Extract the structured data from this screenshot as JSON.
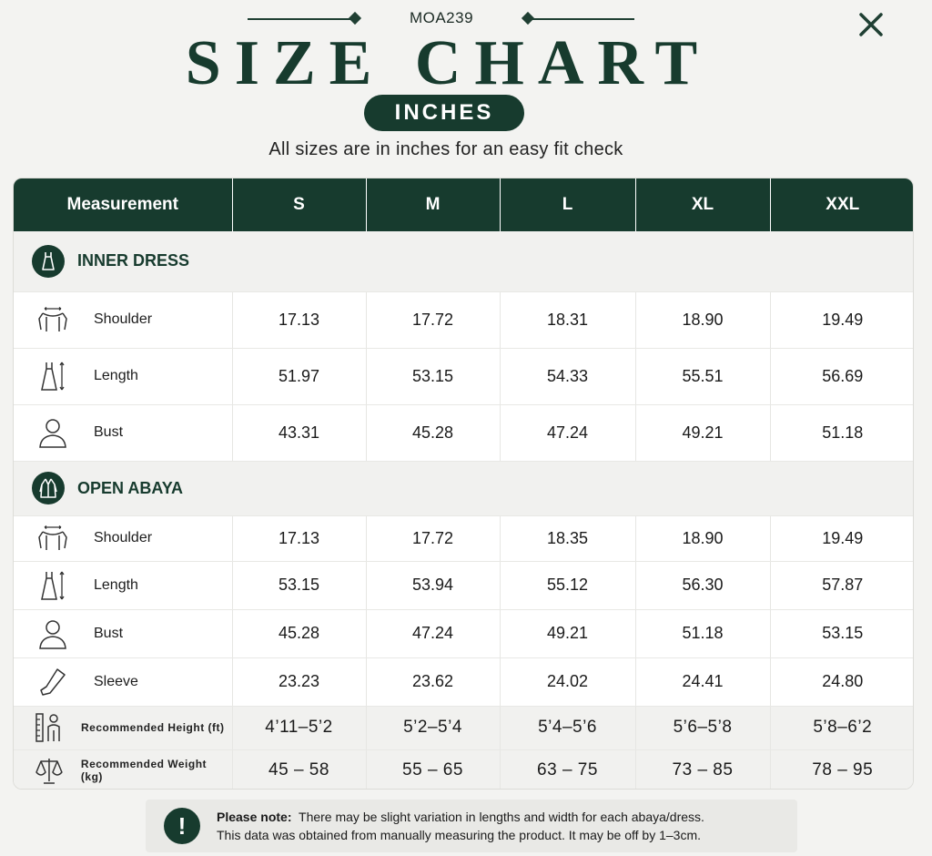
{
  "header": {
    "product_code": "MOA239",
    "title": "SIZE CHART",
    "unit": "INCHES",
    "subtitle": "All sizes are in inches for an easy fit check"
  },
  "table": {
    "columns": [
      "Measurement",
      "S",
      "M",
      "L",
      "XL",
      "XXL"
    ],
    "sections": [
      {
        "label": "INNER DRESS",
        "icon": "dress-icon",
        "rows": [
          {
            "label": "Shoulder",
            "icon": "shoulder-icon",
            "values": [
              "17.13",
              "17.72",
              "18.31",
              "18.90",
              "19.49"
            ]
          },
          {
            "label": "Length",
            "icon": "length-icon",
            "values": [
              "51.97",
              "53.15",
              "54.33",
              "55.51",
              "56.69"
            ]
          },
          {
            "label": "Bust",
            "icon": "bust-icon",
            "values": [
              "43.31",
              "45.28",
              "47.24",
              "49.21",
              "51.18"
            ]
          }
        ]
      },
      {
        "label": "OPEN ABAYA",
        "icon": "abaya-icon",
        "rows": [
          {
            "label": "Shoulder",
            "icon": "shoulder-icon",
            "values": [
              "17.13",
              "17.72",
              "18.35",
              "18.90",
              "19.49"
            ]
          },
          {
            "label": "Length",
            "icon": "length-icon",
            "values": [
              "53.15",
              "53.94",
              "55.12",
              "56.30",
              "57.87"
            ]
          },
          {
            "label": "Bust",
            "icon": "bust-icon",
            "values": [
              "45.28",
              "47.24",
              "49.21",
              "51.18",
              "53.15"
            ]
          },
          {
            "label": "Sleeve",
            "icon": "sleeve-icon",
            "values": [
              "23.23",
              "23.62",
              "24.02",
              "24.41",
              "24.80"
            ]
          }
        ]
      }
    ],
    "recommended": [
      {
        "label": "Recommended Height (ft)",
        "icon": "height-icon",
        "values": [
          "4’11–5’2",
          "5’2–5’4",
          "5’4–5’6",
          "5’6–5’8",
          "5’8–6’2"
        ]
      },
      {
        "label": "Recommended Weight (kg)",
        "icon": "weight-scale-icon",
        "values": [
          "45 – 58",
          "55 – 65",
          "63 – 75",
          "73 – 85",
          "78 – 95"
        ]
      }
    ]
  },
  "note": {
    "heading": "Please note:",
    "line1": "There may be slight variation in lengths and width for each abaya/dress.",
    "line2": "This data was obtained from manually measuring the product. It may be off by 1–3cm."
  },
  "colors": {
    "brand": "#173b2e",
    "background": "#f3f3f1"
  }
}
